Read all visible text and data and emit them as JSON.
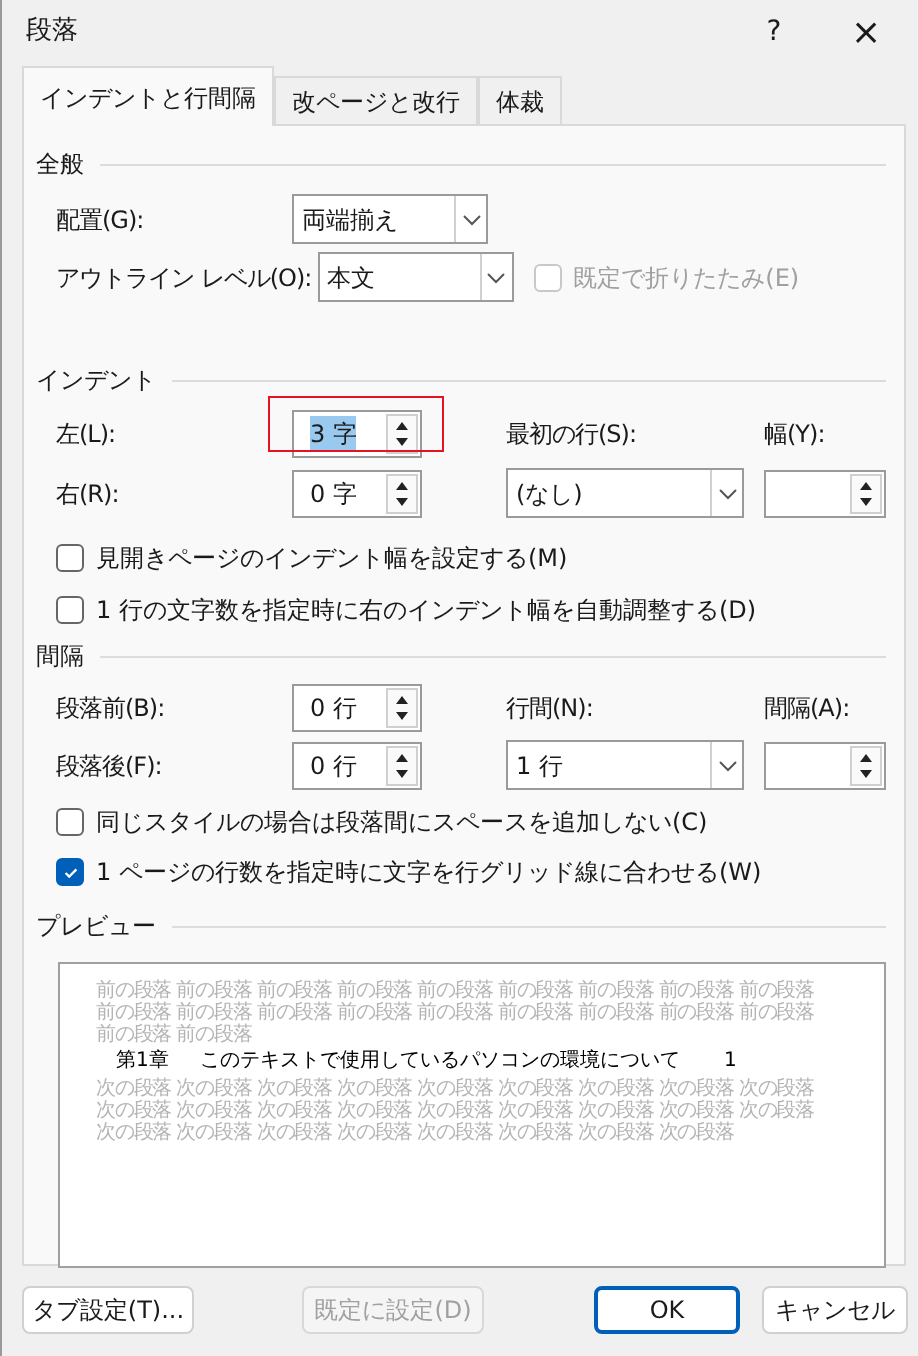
{
  "window": {
    "title": "段落",
    "help": "?",
    "close": "×"
  },
  "tabs": [
    {
      "label": "インデントと行間隔",
      "selected": true
    },
    {
      "label": "改ページと改行",
      "selected": false
    },
    {
      "label": "体裁",
      "selected": false
    }
  ],
  "general": {
    "heading": "全般",
    "alignment": {
      "label": "配置(G):",
      "value": "両端揃え"
    },
    "outline_level": {
      "label": "アウトライン レベル(O):",
      "value": "本文"
    },
    "collapse": {
      "label": "既定で折りたたみ(E)",
      "checked": false,
      "disabled": true
    }
  },
  "indent": {
    "heading": "インデント",
    "left": {
      "label": "左(L):",
      "value": "3 字",
      "text_selected": true,
      "marked": true
    },
    "right": {
      "label": "右(R):",
      "value": "0 字"
    },
    "first_line": {
      "label": "最初の行(S):",
      "value": "(なし)"
    },
    "by": {
      "label": "幅(Y):"
    },
    "checkboxes": [
      {
        "label": "見開きページのインデント幅を設定する(M)",
        "checked": false
      },
      {
        "label": "1 行の文字数を指定時に右のインデント幅を自動調整する(D)",
        "checked": false
      }
    ]
  },
  "spacing": {
    "heading": "間隔",
    "before": {
      "label": "段落前(B):",
      "value": "0 行"
    },
    "after": {
      "label": "段落後(F):",
      "value": "0 行"
    },
    "line_spacing": {
      "label": "行間(N):",
      "value": "1 行"
    },
    "at": {
      "label": "間隔(A):"
    },
    "checkboxes": [
      {
        "label": "同じスタイルの場合は段落間にスペースを追加しない(C)",
        "checked": false
      },
      {
        "label": "1 ページの行数を指定時に文字を行グリッド線に合わせる(W)",
        "checked": true
      }
    ]
  },
  "preview": {
    "heading": "プレビュー",
    "before_lines": [
      "前の段落 前の段落 前の段落 前の段落 前の段落 前の段落 前の段落 前の段落 前の段落",
      "前の段落 前の段落 前の段落 前の段落 前の段落 前の段落 前の段落 前の段落 前の段落",
      "前の段落 前の段落"
    ],
    "sample": {
      "chapter": "第1章",
      "text": "このテキストで使用しているパソコンの環境について",
      "page": "1"
    },
    "after_lines": [
      "次の段落 次の段落 次の段落 次の段落 次の段落 次の段落 次の段落 次の段落 次の段落",
      "次の段落 次の段落 次の段落 次の段落 次の段落 次の段落 次の段落 次の段落 次の段落",
      "次の段落 次の段落 次の段落 次の段落 次の段落 次の段落 次の段落 次の段落"
    ]
  },
  "buttons": [
    {
      "label": "タブ設定(T)...",
      "disabled": false,
      "default": false
    },
    {
      "label": "既定に設定(D)",
      "disabled": true,
      "default": false
    },
    {
      "label": "OK",
      "disabled": false,
      "default": true
    },
    {
      "label": "キャンセル",
      "disabled": false,
      "default": false
    }
  ]
}
